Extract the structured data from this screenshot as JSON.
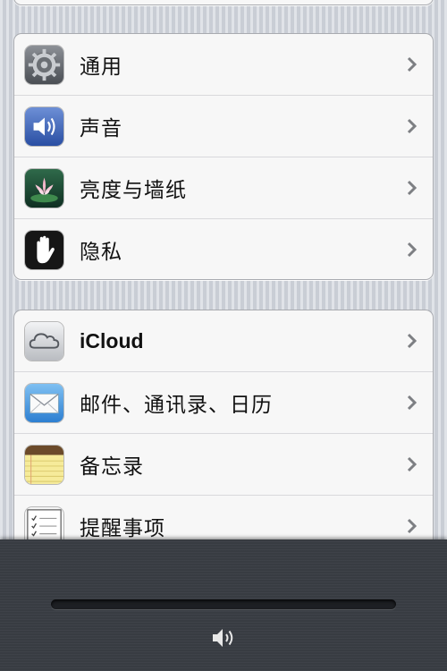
{
  "settings": {
    "group1": [
      {
        "label": "通用",
        "icon": "gear-icon"
      },
      {
        "label": "声音",
        "icon": "speaker-icon"
      },
      {
        "label": "亮度与墙纸",
        "icon": "flower-wallpaper-icon"
      },
      {
        "label": "隐私",
        "icon": "hand-icon"
      }
    ],
    "group2": [
      {
        "label": "iCloud",
        "icon": "cloud-icon"
      },
      {
        "label": "邮件、通讯录、日历",
        "icon": "mail-icon"
      },
      {
        "label": "备忘录",
        "icon": "notepad-icon"
      },
      {
        "label": "提醒事项",
        "icon": "reminders-icon"
      }
    ]
  },
  "volume": {
    "icon": "speaker-volume-icon",
    "level": 0
  },
  "colors": {
    "background": "#cfd4dc",
    "cell": "#f7f7f7",
    "hud": "#3a3e45"
  }
}
